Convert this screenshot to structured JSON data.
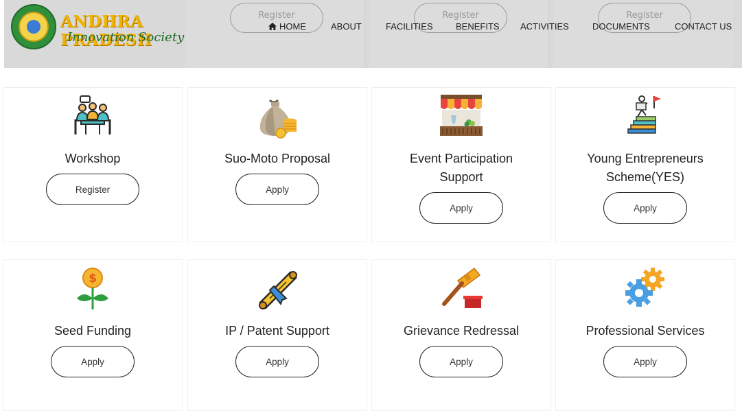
{
  "logo": {
    "title": "ANDHRA PRADESH",
    "subtitle": "Innovation Society"
  },
  "header_ghost_buttons": [
    "Register",
    "Register",
    "Register"
  ],
  "nav": {
    "items": [
      "HOME",
      "ABOUT",
      "FACILITIES",
      "BENEFITS",
      "ACTIVITIES",
      "DOCUMENTS",
      "CONTACT US"
    ]
  },
  "cards": [
    {
      "title": "Workshop",
      "button": "Register",
      "icon": "meeting-icon"
    },
    {
      "title": "Suo-Moto Proposal",
      "button": "Apply",
      "icon": "money-bag-icon"
    },
    {
      "title": "Event Participation Support",
      "button": "Apply",
      "icon": "market-stall-icon"
    },
    {
      "title": "Young Entrepreneurs Scheme(YES)",
      "button": "Apply",
      "icon": "climbing-books-icon"
    },
    {
      "title": "Seed Funding",
      "button": "Apply",
      "icon": "money-plant-icon"
    },
    {
      "title": "IP / Patent Support",
      "button": "Apply",
      "icon": "scroll-certificate-icon"
    },
    {
      "title": "Grievance Redressal",
      "button": "Apply",
      "icon": "gavel-icon"
    },
    {
      "title": "Professional Services",
      "button": "Apply",
      "icon": "gears-icon"
    }
  ],
  "colors": {
    "header_bg": "#d9d9d9",
    "logo_gold": "#f0b400",
    "logo_green": "#1f6b2a",
    "button_border": "#222222"
  }
}
